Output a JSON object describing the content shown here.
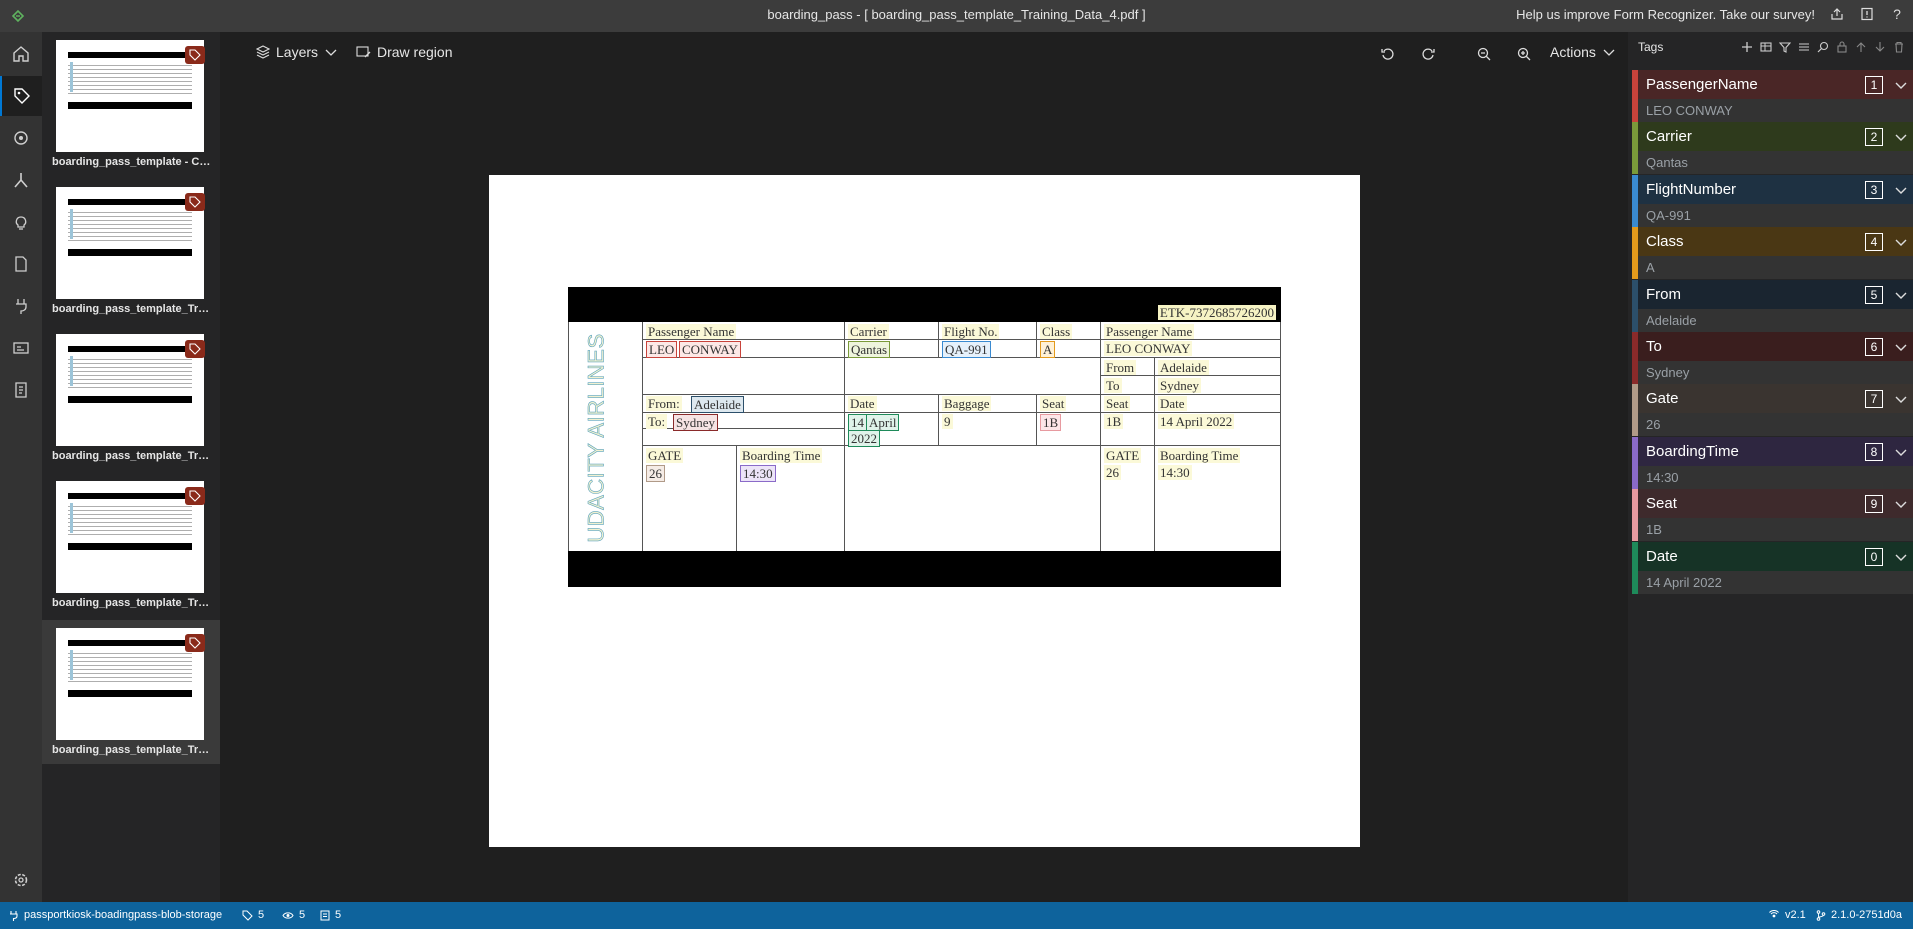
{
  "title": "boarding_pass - [ boarding_pass_template_Training_Data_4.pdf ]",
  "survey_text": "Help us improve Form Recognizer. Take our survey!",
  "toolbar": {
    "layers_label": "Layers",
    "draw_region_label": "Draw region",
    "actions_label": "Actions"
  },
  "thumbnails": [
    {
      "label": "boarding_pass_template - Copy...."
    },
    {
      "label": "boarding_pass_template_Trainin..."
    },
    {
      "label": "boarding_pass_template_Trainin..."
    },
    {
      "label": "boarding_pass_template_Trainin..."
    },
    {
      "label": "boarding_pass_template_Traini..."
    }
  ],
  "document": {
    "etk": "ETK-7372685726200",
    "airline": "UDACITY AIRLINES",
    "h_passenger_name": "Passenger Name",
    "h_carrier": "Carrier",
    "h_flight_no": "Flight No.",
    "h_class": "Class",
    "h_passenger_name_r": "Passenger Name",
    "name_first": "LEO",
    "name_last": "CONWAY",
    "carrier": "Qantas",
    "flight_no": "QA-991",
    "class": "A",
    "name_r": "LEO CONWAY",
    "h_from_r": "From",
    "from_r": "Adelaide",
    "h_to_r": "To",
    "to_r": "Sydney",
    "h_from": "From:",
    "from": "Adelaide",
    "h_to": "To:",
    "to": "Sydney",
    "h_date": "Date",
    "date_1": "14",
    "date_2": "April",
    "date_3": "2022",
    "h_baggage": "Baggage",
    "baggage": "9",
    "h_seat": "Seat",
    "seat": "1B",
    "h_seat_r": "Seat",
    "seat_r": "1B",
    "h_date_r": "Date",
    "date_r": "14 April 2022",
    "h_gate": "GATE",
    "gate": "26",
    "h_boarding_time": "Boarding Time",
    "boarding_time": "14:30",
    "h_gate_r": "GATE",
    "gate_r": "26",
    "h_boarding_time_r": "Boarding Time",
    "boarding_time_r": "14:30"
  },
  "tags_panel": {
    "title": "Tags",
    "tags": [
      {
        "name": "PassengerName",
        "key": "1",
        "value": "LEO CONWAY",
        "color": "#c8433b",
        "head_bg": "#4a2626"
      },
      {
        "name": "Carrier",
        "key": "2",
        "value": "Qantas",
        "color": "#7a9a3a",
        "head_bg": "#2e3a1c"
      },
      {
        "name": "FlightNumber",
        "key": "3",
        "value": "QA-991",
        "color": "#3a8ad0",
        "head_bg": "#1e3142"
      },
      {
        "name": "Class",
        "key": "4",
        "value": "A",
        "color": "#e39a1c",
        "head_bg": "#4a3714"
      },
      {
        "name": "From",
        "key": "5",
        "value": "Adelaide",
        "color": "#2c4f6a",
        "head_bg": "#1a2530"
      },
      {
        "name": "To",
        "key": "6",
        "value": "Sydney",
        "color": "#8a2a2a",
        "head_bg": "#3a1e1e"
      },
      {
        "name": "Gate",
        "key": "7",
        "value": "26",
        "color": "#b09a88",
        "head_bg": "#3a3430"
      },
      {
        "name": "BoardingTime",
        "key": "8",
        "value": "14:30",
        "color": "#8a6ac8",
        "head_bg": "#2e2640"
      },
      {
        "name": "Seat",
        "key": "9",
        "value": "1B",
        "color": "#e79aa0",
        "head_bg": "#3e2a2c"
      },
      {
        "name": "Date",
        "key": "0",
        "value": "14 April 2022",
        "color": "#1e8a5a",
        "head_bg": "#163326"
      }
    ]
  },
  "status": {
    "connection": "passportkiosk-boadingpass-blob-storage",
    "tag_count": "5",
    "visited_count": "5",
    "doc_count": "5",
    "api_version": "v2.1",
    "build": "2.1.0-2751d0a"
  }
}
